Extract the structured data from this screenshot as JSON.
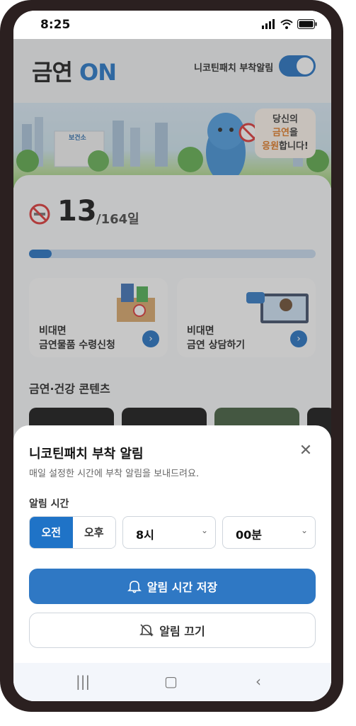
{
  "status_bar": {
    "time": "8:25"
  },
  "header": {
    "logo_main": "금연",
    "logo_on": "ON",
    "notify_label": "니코틴패치 부착알림",
    "notify_enabled": true
  },
  "banner": {
    "bubble_line1": "당신의",
    "bubble_word": "금연",
    "bubble_line2_suffix": "을",
    "bubble_word2": "응원",
    "bubble_line3_suffix": "합니다!",
    "building_sign": "보건소"
  },
  "progress": {
    "current": "13",
    "total": "/164일",
    "fraction": 0.08
  },
  "services": [
    {
      "line1": "비대면",
      "line2": "금연물품 수령신청"
    },
    {
      "line1": "비대면",
      "line2": "금연 상담하기"
    }
  ],
  "content_section_title": "금연·건강 콘텐츠",
  "sheet": {
    "title": "니코틴패치 부착 알림",
    "description": "매일 설정한 시간에 부착 알림을 보내드려요.",
    "time_label": "알림 시간",
    "am": "오전",
    "pm": "오후",
    "hour": "8시",
    "minute": "00분",
    "save_label": "알림 시간 저장",
    "off_label": "알림 끄기"
  },
  "colors": {
    "accent": "#1f73c7",
    "toggle_on": "#1f6fc2"
  }
}
